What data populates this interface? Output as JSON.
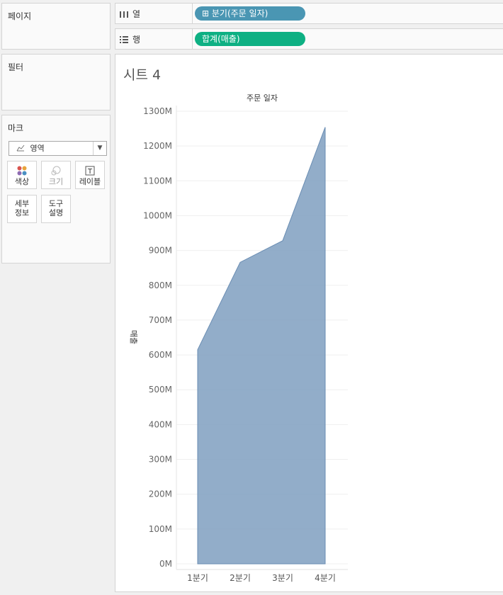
{
  "pages_panel": {
    "title": "페이지"
  },
  "filters_panel": {
    "title": "필터"
  },
  "marks_panel": {
    "title": "마크",
    "mark_type": "영역",
    "buttons": {
      "color": "색상",
      "size": "크기",
      "label": "레이블",
      "detail": [
        "세부",
        "정보"
      ],
      "tooltip": [
        "도구",
        "설명"
      ]
    }
  },
  "columns_shelf": {
    "label": "열",
    "pill": "⊞ 분기(주문 일자)"
  },
  "rows_shelf": {
    "label": "행",
    "pill": "합계(매출)"
  },
  "sheet": {
    "title": "시트 4"
  },
  "colors": {
    "area": "#7f9fc0",
    "column_pill": "#4a96b3",
    "row_pill": "#0eb083"
  },
  "chart_data": {
    "type": "area",
    "header": "주문 일자",
    "ylabel": "매출",
    "xlabel": "",
    "categories": [
      "1분기",
      "2분기",
      "3분기",
      "4분기"
    ],
    "values": [
      615,
      866,
      928,
      1254
    ],
    "ylim": [
      0,
      1300
    ],
    "yticks": [
      "0M",
      "100M",
      "200M",
      "300M",
      "400M",
      "500M",
      "600M",
      "700M",
      "800M",
      "900M",
      "1000M",
      "1100M",
      "1200M",
      "1300M"
    ],
    "ytick_values": [
      0,
      100,
      200,
      300,
      400,
      500,
      600,
      700,
      800,
      900,
      1000,
      1100,
      1200,
      1300
    ],
    "grid": true,
    "legend": "none"
  }
}
